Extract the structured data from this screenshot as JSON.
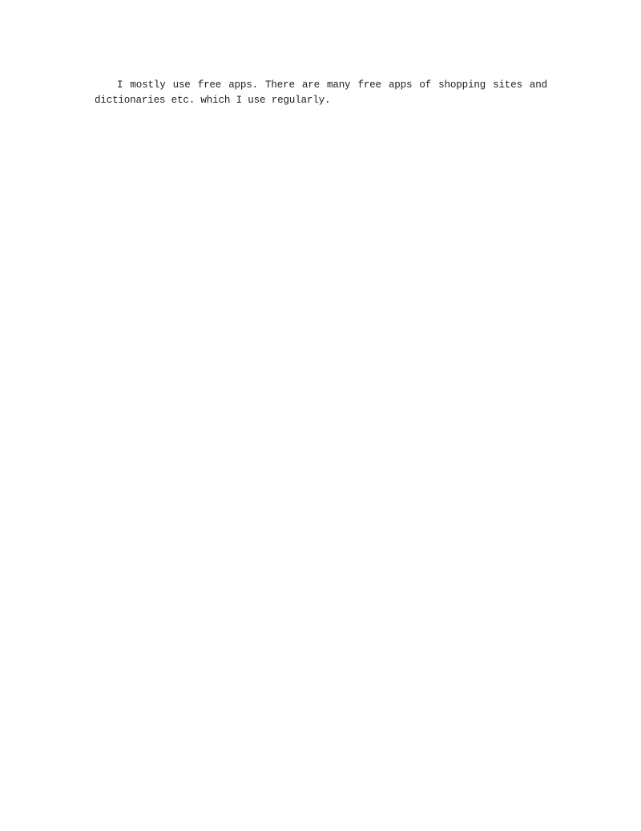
{
  "document": {
    "paragraphs": [
      "I mostly use free apps. There are many free apps of shopping sites and dictionaries etc. which I use regularly."
    ]
  }
}
